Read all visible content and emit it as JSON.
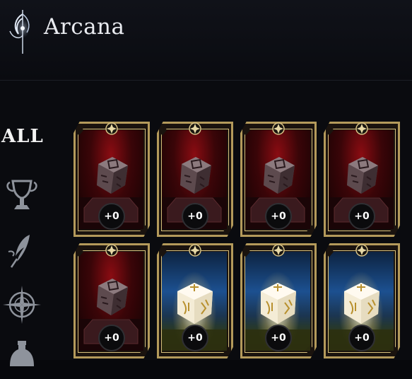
{
  "header": {
    "title": "Arcana",
    "title_icon": "arcana-crest-icon"
  },
  "sidebar": {
    "all_label": "ALL",
    "icons": [
      "chalice-icon",
      "quill-icon",
      "compass-icon",
      "potion-icon"
    ]
  },
  "cards": [
    {
      "type": "red",
      "level": "+0"
    },
    {
      "type": "red",
      "level": "+0"
    },
    {
      "type": "red",
      "level": "+0"
    },
    {
      "type": "red",
      "level": "+0"
    },
    {
      "type": "red",
      "level": "+0"
    },
    {
      "type": "blue",
      "level": "+0"
    },
    {
      "type": "blue",
      "level": "+0"
    },
    {
      "type": "blue",
      "level": "+0"
    }
  ],
  "colors": {
    "frame_gold": "#b49a5b",
    "background": "#07080c",
    "card_red": "#8a0c12",
    "card_blue": "#1c5090"
  }
}
